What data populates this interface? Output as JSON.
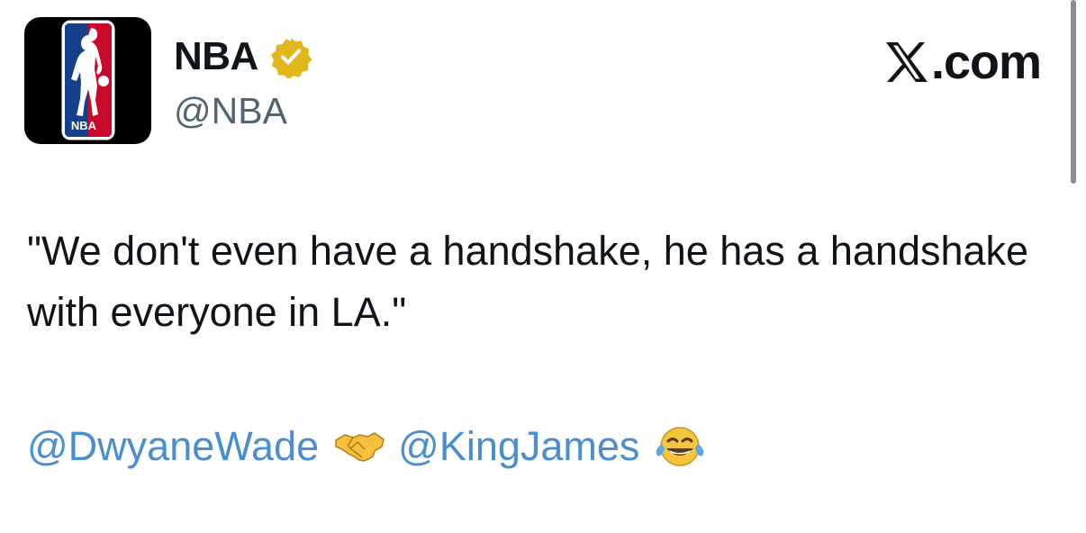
{
  "account": {
    "display_name": "NBA",
    "handle": "@NBA",
    "avatar_icon": "nba-logo-icon",
    "avatar_logo_text": "NBA",
    "verified_icon": "gold-verified-badge-icon"
  },
  "brand": {
    "icon": "x-logo-icon",
    "text": ".com"
  },
  "tweet": {
    "text": "\"We don't even have a handshake, he has a handshake with everyone in LA.\"",
    "mentions": [
      {
        "text": "@DwyaneWade",
        "emoji_after": "handshake-emoji"
      },
      {
        "text": "@KingJames",
        "emoji_after": "face-with-tears-of-joy-emoji"
      }
    ]
  },
  "colors": {
    "text": "#0f1419",
    "secondary_text": "#536471",
    "link": "#4b8ed0",
    "verified_gold": "#e2b719",
    "nba_red": "#c9082a",
    "nba_blue": "#17408b"
  }
}
